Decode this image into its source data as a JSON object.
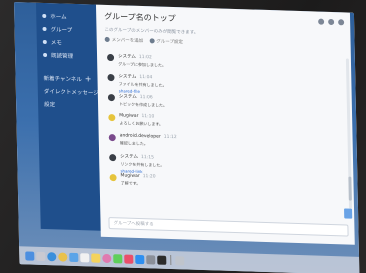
{
  "sidebar": {
    "items": [
      {
        "label": "ホーム",
        "icon": "home-icon"
      },
      {
        "label": "グループ",
        "icon": "group-icon"
      },
      {
        "label": "メモ",
        "icon": "note-icon"
      },
      {
        "label": "既読管理",
        "icon": "read-icon"
      }
    ],
    "sections": [
      {
        "label": "新着チャンネル",
        "add": "+"
      },
      {
        "label": "ダイレクトメッセージ",
        "add": "+"
      },
      {
        "label": "設定",
        "add": ""
      }
    ]
  },
  "main": {
    "title": "グループ名のトップ",
    "subtitle": "このグループのメンバーのみが閲覧できます。",
    "toolbar": [
      "メンバーを追加",
      "グループ設定"
    ],
    "messages": [
      {
        "user": "システム",
        "time": "11:02",
        "lines": [
          "グループに参加しました。"
        ]
      },
      {
        "user": "システム",
        "time": "11:04",
        "lines": [
          "ファイルを共有しました。",
          "shared-file"
        ]
      },
      {
        "user": "システム",
        "time": "11:06",
        "lines": [
          "トピックを作成しました。"
        ]
      },
      {
        "user": "Mugiwar",
        "time": "11:10",
        "lines": [
          "よろしくお願いします。"
        ]
      },
      {
        "user": "android.developer",
        "time": "11:12",
        "lines": [
          "確認しました。"
        ]
      },
      {
        "user": "システム",
        "time": "11:15",
        "lines": [
          "リンクを共有しました。",
          "shared-link"
        ]
      },
      {
        "user": "Mugiwar",
        "time": "11:20",
        "lines": [
          "了解です。"
        ]
      }
    ],
    "composer_placeholder": "グループへ投稿する"
  },
  "colors": {
    "sidebar": "#1f4f8c",
    "accent": "#2a6bd6",
    "wallpaper": "#3b6fad"
  },
  "dock": {
    "icons": [
      "finder-icon",
      "launchpad-icon",
      "safari-icon",
      "chrome-icon",
      "mail-icon",
      "calendar-icon",
      "notes-icon",
      "photos-icon",
      "messages-icon",
      "music-icon",
      "appstore-icon",
      "settings-icon",
      "terminal-icon",
      "trash-icon"
    ]
  }
}
